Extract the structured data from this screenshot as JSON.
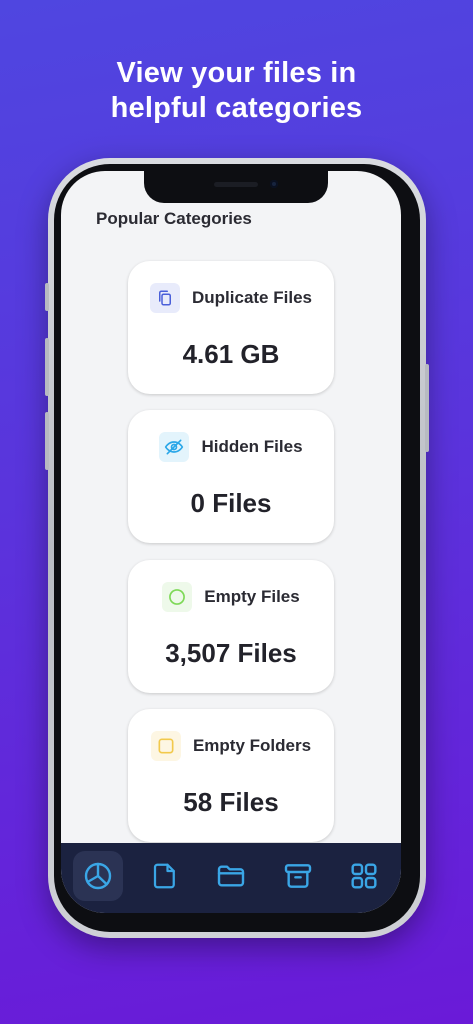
{
  "headline": {
    "line1": "View your files in",
    "line2": "helpful categories"
  },
  "screen": {
    "section_title": "Popular Categories",
    "cards": [
      {
        "label": "Duplicate Files",
        "value": "4.61 GB",
        "icon": "duplicate-icon",
        "accent": "#4a5fd9",
        "badge_bg": "#e8ebfb"
      },
      {
        "label": "Hidden Files",
        "value": "0 Files",
        "icon": "eye-off-icon",
        "accent": "#2aa7e8",
        "badge_bg": "#e3f4fc"
      },
      {
        "label": "Empty Files",
        "value": "3,507 Files",
        "icon": "circle-icon",
        "accent": "#7ed957",
        "badge_bg": "#eef9ea"
      },
      {
        "label": "Empty Folders",
        "value": "58 Files",
        "icon": "square-icon",
        "accent": "#f2c94c",
        "badge_bg": "#fdf6e3"
      }
    ],
    "tabbar": {
      "icon_color": "#3aa6e6",
      "items": [
        {
          "icon": "pie-chart-icon",
          "active": true
        },
        {
          "icon": "file-icon",
          "active": false
        },
        {
          "icon": "folder-icon",
          "active": false
        },
        {
          "icon": "archive-icon",
          "active": false
        },
        {
          "icon": "grid-icon",
          "active": false
        }
      ]
    }
  }
}
